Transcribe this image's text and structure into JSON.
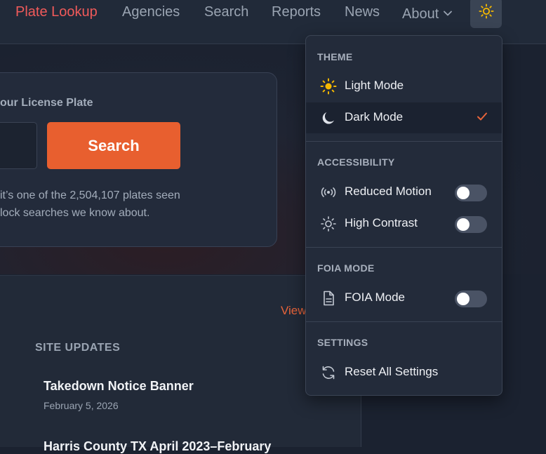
{
  "nav": {
    "brand": "Plate Lookup",
    "links": [
      "Agencies",
      "Search",
      "Reports",
      "News",
      "About"
    ],
    "theme_button_icon": "sun-icon"
  },
  "hero": {
    "label": "our License Plate",
    "button": "Search",
    "note_line1": "it’s one of the 2,504,107 plates seen",
    "note_line2": "lock searches we know about."
  },
  "content": {
    "view_link": "View",
    "updates_heading": "SITE UPDATES",
    "updates": [
      {
        "title": "Takedown Notice Banner",
        "date": "February 5, 2026"
      },
      {
        "title": "Harris County TX April 2023–February"
      }
    ]
  },
  "menu": {
    "theme": {
      "heading": "THEME",
      "items": [
        {
          "label": "Light Mode",
          "icon": "sun-icon"
        },
        {
          "label": "Dark Mode",
          "icon": "moon-icon",
          "selected": true
        }
      ]
    },
    "accessibility": {
      "heading": "ACCESSIBILITY",
      "items": [
        {
          "label": "Reduced Motion",
          "icon": "broadcast-icon",
          "on": false
        },
        {
          "label": "High Contrast",
          "icon": "contrast-sun-icon",
          "on": false
        }
      ]
    },
    "foia": {
      "heading": "FOIA MODE",
      "items": [
        {
          "label": "FOIA Mode",
          "icon": "document-icon",
          "on": false
        }
      ]
    },
    "settings": {
      "heading": "SETTINGS",
      "items": [
        {
          "label": "Reset All Settings",
          "icon": "reset-icon"
        }
      ]
    }
  },
  "colors": {
    "brand": "#f05a5a",
    "accent": "#e85f2f",
    "sun": "#f5b800",
    "check": "#e8643a"
  }
}
